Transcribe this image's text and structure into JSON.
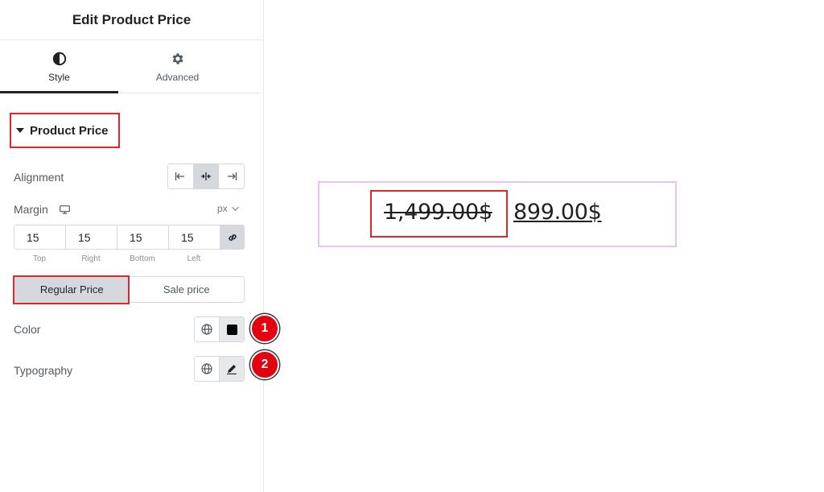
{
  "panel": {
    "title": "Edit Product Price",
    "tabs": [
      {
        "label": "Style",
        "icon": "half-circle-icon",
        "active": true
      },
      {
        "label": "Advanced",
        "icon": "gear-icon",
        "active": false
      }
    ]
  },
  "section": {
    "title": "Product Price"
  },
  "controls": {
    "alignment": {
      "label": "Alignment",
      "options": [
        "align-left-icon",
        "align-center-icon",
        "align-right-icon"
      ],
      "selected": "center"
    },
    "margin": {
      "label": "Margin",
      "unit": "px",
      "values": {
        "top": "15",
        "right": "15",
        "bottom": "15",
        "left": "15"
      },
      "labels": {
        "top": "Top",
        "right": "Right",
        "bottom": "Bottom",
        "left": "Left"
      }
    },
    "price_toggle": {
      "regular": "Regular Price",
      "sale": "Sale price",
      "selected": "regular"
    },
    "color": {
      "label": "Color",
      "swatch": "#000000"
    },
    "typography": {
      "label": "Typography"
    }
  },
  "badges": {
    "one": "1",
    "two": "2"
  },
  "preview": {
    "regular_price": "1,499.00$",
    "sale_price": "899.00$"
  },
  "colors": {
    "highlight": "#e0262b",
    "badge": "#e3000f",
    "widget_outline": "#e8c5f0"
  }
}
